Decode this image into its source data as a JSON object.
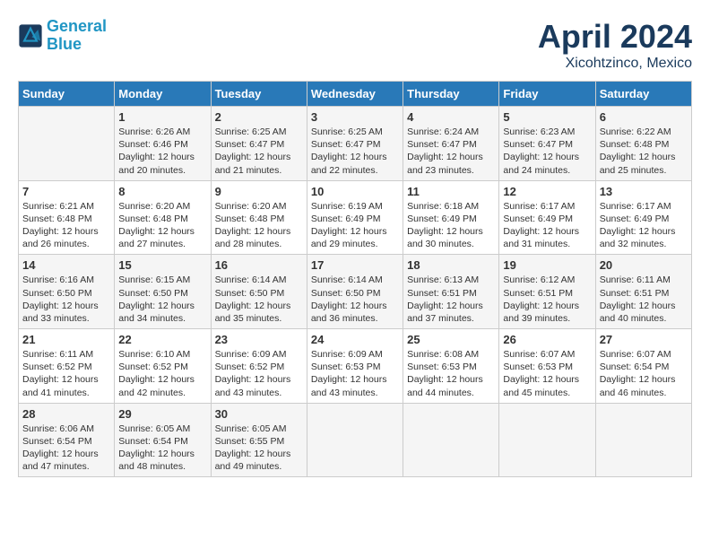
{
  "logo": {
    "text_general": "General",
    "text_blue": "Blue"
  },
  "header": {
    "month": "April 2024",
    "location": "Xicohtzinco, Mexico"
  },
  "days_of_week": [
    "Sunday",
    "Monday",
    "Tuesday",
    "Wednesday",
    "Thursday",
    "Friday",
    "Saturday"
  ],
  "weeks": [
    [
      {
        "day": "",
        "sunrise": "",
        "sunset": "",
        "daylight": ""
      },
      {
        "day": "1",
        "sunrise": "Sunrise: 6:26 AM",
        "sunset": "Sunset: 6:46 PM",
        "daylight": "Daylight: 12 hours and 20 minutes."
      },
      {
        "day": "2",
        "sunrise": "Sunrise: 6:25 AM",
        "sunset": "Sunset: 6:47 PM",
        "daylight": "Daylight: 12 hours and 21 minutes."
      },
      {
        "day": "3",
        "sunrise": "Sunrise: 6:25 AM",
        "sunset": "Sunset: 6:47 PM",
        "daylight": "Daylight: 12 hours and 22 minutes."
      },
      {
        "day": "4",
        "sunrise": "Sunrise: 6:24 AM",
        "sunset": "Sunset: 6:47 PM",
        "daylight": "Daylight: 12 hours and 23 minutes."
      },
      {
        "day": "5",
        "sunrise": "Sunrise: 6:23 AM",
        "sunset": "Sunset: 6:47 PM",
        "daylight": "Daylight: 12 hours and 24 minutes."
      },
      {
        "day": "6",
        "sunrise": "Sunrise: 6:22 AM",
        "sunset": "Sunset: 6:48 PM",
        "daylight": "Daylight: 12 hours and 25 minutes."
      }
    ],
    [
      {
        "day": "7",
        "sunrise": "Sunrise: 6:21 AM",
        "sunset": "Sunset: 6:48 PM",
        "daylight": "Daylight: 12 hours and 26 minutes."
      },
      {
        "day": "8",
        "sunrise": "Sunrise: 6:20 AM",
        "sunset": "Sunset: 6:48 PM",
        "daylight": "Daylight: 12 hours and 27 minutes."
      },
      {
        "day": "9",
        "sunrise": "Sunrise: 6:20 AM",
        "sunset": "Sunset: 6:48 PM",
        "daylight": "Daylight: 12 hours and 28 minutes."
      },
      {
        "day": "10",
        "sunrise": "Sunrise: 6:19 AM",
        "sunset": "Sunset: 6:49 PM",
        "daylight": "Daylight: 12 hours and 29 minutes."
      },
      {
        "day": "11",
        "sunrise": "Sunrise: 6:18 AM",
        "sunset": "Sunset: 6:49 PM",
        "daylight": "Daylight: 12 hours and 30 minutes."
      },
      {
        "day": "12",
        "sunrise": "Sunrise: 6:17 AM",
        "sunset": "Sunset: 6:49 PM",
        "daylight": "Daylight: 12 hours and 31 minutes."
      },
      {
        "day": "13",
        "sunrise": "Sunrise: 6:17 AM",
        "sunset": "Sunset: 6:49 PM",
        "daylight": "Daylight: 12 hours and 32 minutes."
      }
    ],
    [
      {
        "day": "14",
        "sunrise": "Sunrise: 6:16 AM",
        "sunset": "Sunset: 6:50 PM",
        "daylight": "Daylight: 12 hours and 33 minutes."
      },
      {
        "day": "15",
        "sunrise": "Sunrise: 6:15 AM",
        "sunset": "Sunset: 6:50 PM",
        "daylight": "Daylight: 12 hours and 34 minutes."
      },
      {
        "day": "16",
        "sunrise": "Sunrise: 6:14 AM",
        "sunset": "Sunset: 6:50 PM",
        "daylight": "Daylight: 12 hours and 35 minutes."
      },
      {
        "day": "17",
        "sunrise": "Sunrise: 6:14 AM",
        "sunset": "Sunset: 6:50 PM",
        "daylight": "Daylight: 12 hours and 36 minutes."
      },
      {
        "day": "18",
        "sunrise": "Sunrise: 6:13 AM",
        "sunset": "Sunset: 6:51 PM",
        "daylight": "Daylight: 12 hours and 37 minutes."
      },
      {
        "day": "19",
        "sunrise": "Sunrise: 6:12 AM",
        "sunset": "Sunset: 6:51 PM",
        "daylight": "Daylight: 12 hours and 39 minutes."
      },
      {
        "day": "20",
        "sunrise": "Sunrise: 6:11 AM",
        "sunset": "Sunset: 6:51 PM",
        "daylight": "Daylight: 12 hours and 40 minutes."
      }
    ],
    [
      {
        "day": "21",
        "sunrise": "Sunrise: 6:11 AM",
        "sunset": "Sunset: 6:52 PM",
        "daylight": "Daylight: 12 hours and 41 minutes."
      },
      {
        "day": "22",
        "sunrise": "Sunrise: 6:10 AM",
        "sunset": "Sunset: 6:52 PM",
        "daylight": "Daylight: 12 hours and 42 minutes."
      },
      {
        "day": "23",
        "sunrise": "Sunrise: 6:09 AM",
        "sunset": "Sunset: 6:52 PM",
        "daylight": "Daylight: 12 hours and 43 minutes."
      },
      {
        "day": "24",
        "sunrise": "Sunrise: 6:09 AM",
        "sunset": "Sunset: 6:53 PM",
        "daylight": "Daylight: 12 hours and 43 minutes."
      },
      {
        "day": "25",
        "sunrise": "Sunrise: 6:08 AM",
        "sunset": "Sunset: 6:53 PM",
        "daylight": "Daylight: 12 hours and 44 minutes."
      },
      {
        "day": "26",
        "sunrise": "Sunrise: 6:07 AM",
        "sunset": "Sunset: 6:53 PM",
        "daylight": "Daylight: 12 hours and 45 minutes."
      },
      {
        "day": "27",
        "sunrise": "Sunrise: 6:07 AM",
        "sunset": "Sunset: 6:54 PM",
        "daylight": "Daylight: 12 hours and 46 minutes."
      }
    ],
    [
      {
        "day": "28",
        "sunrise": "Sunrise: 6:06 AM",
        "sunset": "Sunset: 6:54 PM",
        "daylight": "Daylight: 12 hours and 47 minutes."
      },
      {
        "day": "29",
        "sunrise": "Sunrise: 6:05 AM",
        "sunset": "Sunset: 6:54 PM",
        "daylight": "Daylight: 12 hours and 48 minutes."
      },
      {
        "day": "30",
        "sunrise": "Sunrise: 6:05 AM",
        "sunset": "Sunset: 6:55 PM",
        "daylight": "Daylight: 12 hours and 49 minutes."
      },
      {
        "day": "",
        "sunrise": "",
        "sunset": "",
        "daylight": ""
      },
      {
        "day": "",
        "sunrise": "",
        "sunset": "",
        "daylight": ""
      },
      {
        "day": "",
        "sunrise": "",
        "sunset": "",
        "daylight": ""
      },
      {
        "day": "",
        "sunrise": "",
        "sunset": "",
        "daylight": ""
      }
    ]
  ]
}
